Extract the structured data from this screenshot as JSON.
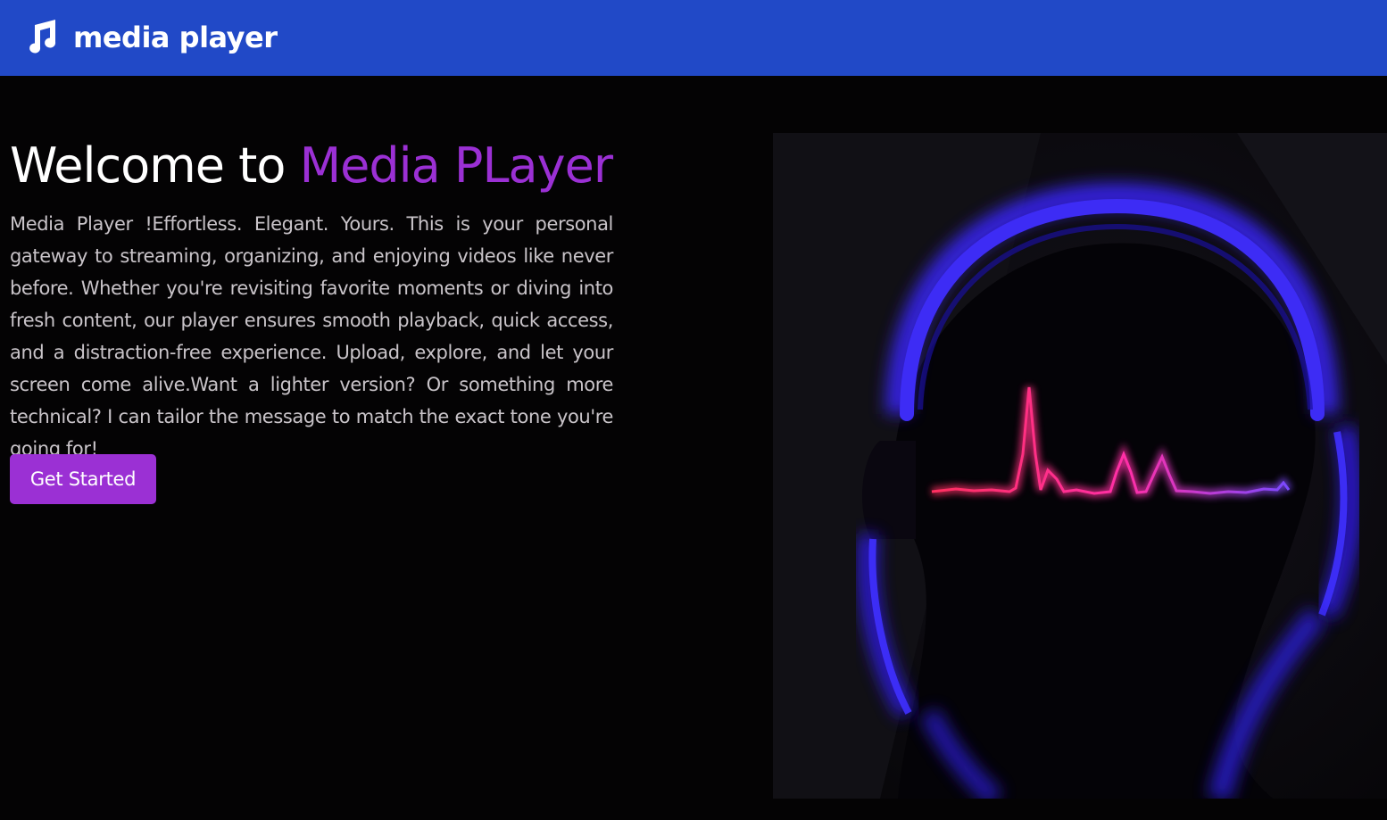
{
  "navbar": {
    "brand_icon": "music-note-icon",
    "brand_name": "media player",
    "background_color": "#2149c7"
  },
  "hero": {
    "title_prefix": "Welcome to ",
    "title_accent": "Media PLayer",
    "accent_color": "#9b30d4",
    "description": "Media Player !Effortless. Elegant. Yours. This is your personal gateway to streaming, organizing, and enjoying videos like never before. Whether you're revisiting favorite moments or diving into fresh content, our player ensures smooth playback, quick access, and a distraction-free experience. Upload, explore, and let your screen come alive.Want a lighter version? Or something more technical? I can tailor the message to match the exact tone you're going for!",
    "cta_label": "Get Started",
    "illustration": "neon-headphones-with-audio-waveform"
  }
}
